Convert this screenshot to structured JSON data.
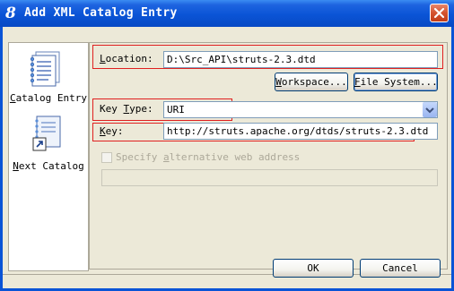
{
  "window": {
    "title": "Add XML Catalog Entry",
    "title_icon": "8",
    "close_icon": "close-icon"
  },
  "sidebar": {
    "items": [
      {
        "label": "Catalog Entry",
        "mnemonic": "C",
        "rest": "atalog Entry",
        "icon": "catalog-entry-icon"
      },
      {
        "label": "Next Catalog",
        "mnemonic": "N",
        "rest": "ext Catalog",
        "icon": "next-catalog-icon"
      }
    ]
  },
  "form": {
    "location_label_m": "L",
    "location_label_rest": "ocation:",
    "location_value": "D:\\Src_API\\struts-2.3.dtd",
    "workspace_button": "Workspace...",
    "workspace_m": "W",
    "workspace_rest": "orkspace...",
    "filesystem_button": "File System...",
    "filesystem_m": "F",
    "filesystem_rest": "ile System...",
    "keytype_label_pre": "Key ",
    "keytype_label_m": "T",
    "keytype_label_rest": "ype:",
    "keytype_value": "URI",
    "key_label_m": "K",
    "key_label_rest": "ey:",
    "key_value": "http://struts.apache.org/dtds/struts-2.3.dtd",
    "alt_checkbox_pre": "Specify ",
    "alt_checkbox_m": "a",
    "alt_checkbox_rest": "lternative web address",
    "alt_web_value": ""
  },
  "buttons": {
    "ok": "OK",
    "cancel": "Cancel"
  },
  "colors": {
    "titlebar": "#0a54d6",
    "dialog_bg": "#ece9d8",
    "highlight_box": "#e02020"
  }
}
